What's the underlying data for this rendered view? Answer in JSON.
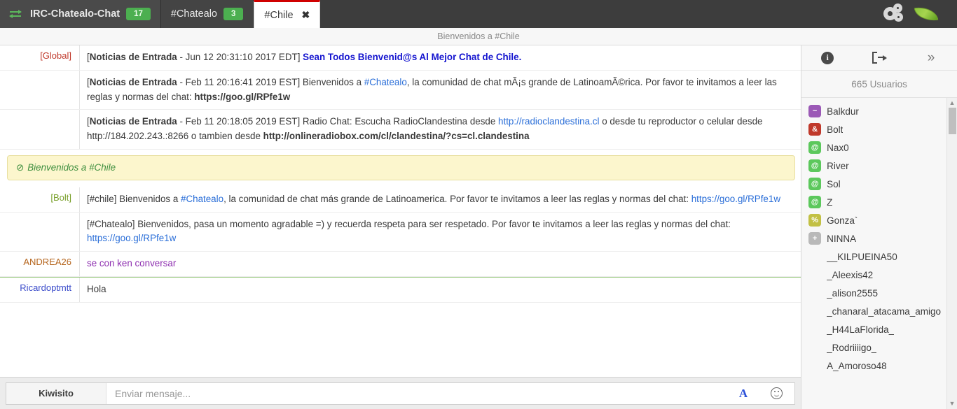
{
  "tabs": [
    {
      "label": "IRC-Chatealo-Chat",
      "badge": "17",
      "icon": "swap-icon",
      "active": false,
      "type": "server"
    },
    {
      "label": "#Chatealo",
      "badge": "3",
      "active": false,
      "type": "channel"
    },
    {
      "label": "#Chile",
      "badge": "",
      "active": true,
      "type": "channel",
      "close": "✖"
    }
  ],
  "header_icons": [
    {
      "name": "settings-gears-icon"
    },
    {
      "name": "kiwi-leaf-logo"
    }
  ],
  "topic": "Bienvenidos a #Chile",
  "messages": [
    {
      "nick": "[Global]",
      "nick_class": "nick-global",
      "parts": [
        {
          "t": "[",
          "s": "plain"
        },
        {
          "t": "Noticias de Entrada",
          "s": "bold"
        },
        {
          "t": " - Jun 12 20:31:10 2017 EDT] ",
          "s": "plain"
        },
        {
          "t": "Sean Todos Bienvenid@s Al Mejor Chat de Chile.",
          "s": "blue-bold"
        }
      ]
    },
    {
      "nick": "",
      "nick_class": "",
      "parts": [
        {
          "t": "[",
          "s": "plain"
        },
        {
          "t": "Noticias de Entrada",
          "s": "bold"
        },
        {
          "t": " - Feb 11 20:16:41 2019 EST] Bienvenidos a ",
          "s": "plain"
        },
        {
          "t": "#Chatealo",
          "s": "link"
        },
        {
          "t": ", la comunidad de chat mÃ¡s grande de LatinoamÃ©rica. Por favor te invitamos a leer las reglas y normas del chat: ",
          "s": "plain"
        },
        {
          "t": "https://goo.gl/RPfe1w",
          "s": "bold"
        }
      ]
    },
    {
      "nick": "",
      "nick_class": "",
      "parts": [
        {
          "t": "[",
          "s": "plain"
        },
        {
          "t": "Noticias de Entrada",
          "s": "bold"
        },
        {
          "t": " - Feb 11 20:18:05 2019 EST] Radio Chat: Escucha RadioClandestina desde ",
          "s": "plain"
        },
        {
          "t": "http://radioclandestina.cl",
          "s": "link"
        },
        {
          "t": " o desde tu reproductor o celular desde http://184.202.243.:8266 o tambien desde ",
          "s": "plain"
        },
        {
          "t": "http://onlineradiobox.com/cl/clandestina/?cs=cl.clandestina",
          "s": "bold"
        }
      ]
    }
  ],
  "topic_banner": {
    "icon": "⊘",
    "text_before": "Bienvenidos a ",
    "channel": "#Chile"
  },
  "messages2": [
    {
      "nick": "[Bolt]",
      "nick_class": "nick-bolt",
      "parts": [
        {
          "t": "[#chile] Bienvenidos a ",
          "s": "plain"
        },
        {
          "t": "#Chatealo",
          "s": "link"
        },
        {
          "t": ", la comunidad de chat más grande de Latinoamerica. Por favor te invitamos a leer las reglas y normas del chat: ",
          "s": "plain"
        },
        {
          "t": "https://goo.gl/RPfe1w",
          "s": "link"
        }
      ]
    },
    {
      "nick": "",
      "nick_class": "",
      "parts": [
        {
          "t": "[#Chatealo] Bienvenidos, pasa un momento agradable =) y recuerda respeta para ser respetado. Por favor te invitamos a leer las reglas y normas del chat: ",
          "s": "plain"
        },
        {
          "t": "https://goo.gl/RPfe1w",
          "s": "link"
        }
      ]
    },
    {
      "nick": "ANDREA26",
      "nick_class": "nick-andrea",
      "parts": [
        {
          "t": "se con ken conversar",
          "s": "purple"
        }
      ]
    },
    {
      "nick": "Ricardoptmtt",
      "nick_class": "nick-ricardo",
      "unread_separator": true,
      "parts": [
        {
          "t": "Hola",
          "s": "plain"
        }
      ]
    }
  ],
  "userpanel": {
    "tools": [
      {
        "name": "channel-info-icon",
        "label": "i"
      },
      {
        "name": "leave-channel-icon",
        "label": ""
      },
      {
        "name": "collapse-panel-icon",
        "label": "»"
      }
    ],
    "count_label": "665 Usuarios",
    "users": [
      {
        "name": "Balkdur",
        "badge": "~",
        "badge_color": "#9b59b6"
      },
      {
        "name": "Bolt",
        "badge": "&",
        "badge_color": "#c0392b"
      },
      {
        "name": "Nax0",
        "badge": "@",
        "badge_color": "#5cc85c"
      },
      {
        "name": "River",
        "badge": "@",
        "badge_color": "#5cc85c"
      },
      {
        "name": "Sol",
        "badge": "@",
        "badge_color": "#5cc85c"
      },
      {
        "name": "Z",
        "badge": "@",
        "badge_color": "#5cc85c"
      },
      {
        "name": "Gonza`",
        "badge": "%",
        "badge_color": "#c2c044"
      },
      {
        "name": "NINNA",
        "badge": "+",
        "badge_color": "#b9b9b9"
      },
      {
        "name": "__KILPUEINA50",
        "badge": "",
        "badge_color": ""
      },
      {
        "name": "_Aleexis42",
        "badge": "",
        "badge_color": ""
      },
      {
        "name": "_alison2555",
        "badge": "",
        "badge_color": ""
      },
      {
        "name": "_chanaral_atacama_amigo",
        "badge": "",
        "badge_color": ""
      },
      {
        "name": "_H44LaFlorida_",
        "badge": "",
        "badge_color": ""
      },
      {
        "name": "_Rodriiiigo_",
        "badge": "",
        "badge_color": ""
      },
      {
        "name": "A_Amoroso48",
        "badge": "",
        "badge_color": ""
      }
    ],
    "scroll_up": "▲",
    "scroll_down": "▼"
  },
  "input": {
    "nick": "Kiwisito",
    "placeholder": "Enviar mensaje...",
    "value": "",
    "format_label": "A",
    "emoji_name": "smiley-icon"
  },
  "colors": {
    "accent_red": "#d00000",
    "badge_green": "#4caf50",
    "link_blue": "#2a6ed8",
    "topic_yellow": "#fcf6cd"
  }
}
